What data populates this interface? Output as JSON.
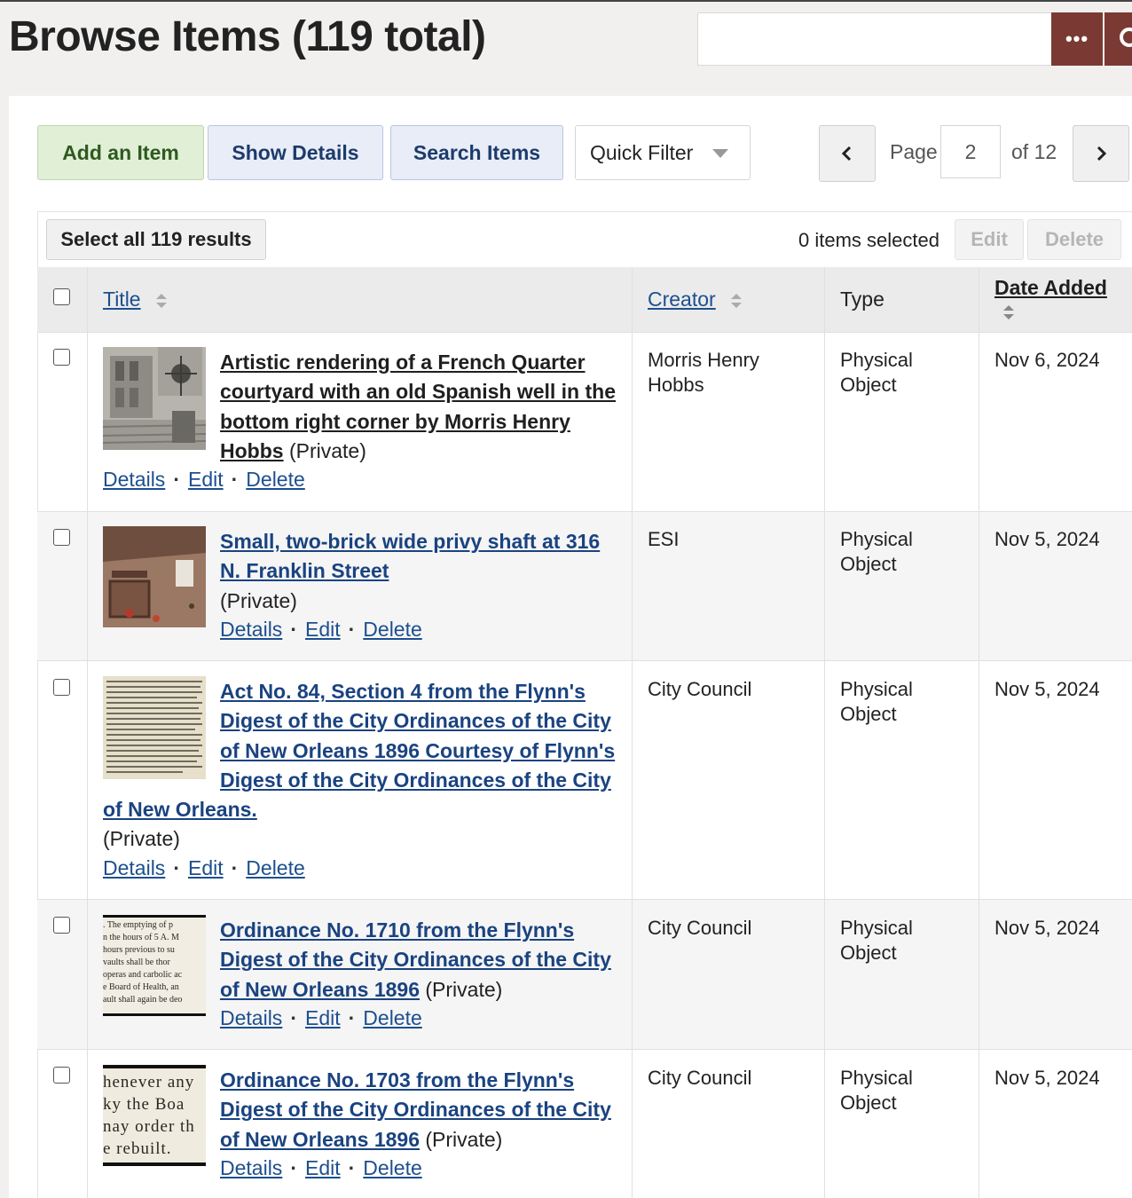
{
  "header": {
    "title": "Browse Items (119 total)",
    "search_value": "",
    "search_options_label": "•••"
  },
  "toolbar": {
    "add_label": "Add an Item",
    "details_label": "Show Details",
    "search_label": "Search Items",
    "filter_label": "Quick Filter"
  },
  "pagination": {
    "page_label": "Page",
    "current_page": "2",
    "of_label": "of 12"
  },
  "batch": {
    "select_all_label": "Select all 119 results",
    "selected_text": "0 items selected",
    "edit_label": "Edit",
    "delete_label": "Delete"
  },
  "table": {
    "columns": {
      "title": "Title",
      "creator": "Creator",
      "type": "Type",
      "date": "Date Added"
    },
    "rows": [
      {
        "title": "Artistic rendering of a French Quarter courtyard with an old Spanish well in the bottom right corner by Morris Henry Hobbs",
        "status": "(Private)",
        "creator": "Morris Henry Hobbs",
        "type": "Physical Object",
        "date": "Nov 6, 2024",
        "thumb": "sketch-courtyard"
      },
      {
        "title": "Small, two-brick wide privy shaft at 316 N. Franklin Street",
        "status": "(Private)",
        "creator": "ESI",
        "type": "Physical Object",
        "date": "Nov 5, 2024",
        "thumb": "excavation-photo"
      },
      {
        "title": "Act No. 84, Section 4 from the Flynn's Digest of the City Ordinances of the City of New Orleans 1896 Courtesy of Flynn's Digest of the City Ordinances of the City of New Orleans.",
        "status": "(Private)",
        "creator": "City Council",
        "type": "Physical Object",
        "date": "Nov 5, 2024",
        "thumb": "newsprint-page"
      },
      {
        "title": "Ordinance No. 1710 from the Flynn's Digest of the City Ordinances of the City of New Orleans 1896",
        "status": "(Private)",
        "creator": "City Council",
        "type": "Physical Object",
        "date": "Nov 5, 2024",
        "thumb": "newsprint-snippet",
        "thumb_lines": [
          ". The emptying of p",
          "n the hours of 5 A. M",
          "hours previous to su",
          "vaults shall be thor",
          "operas and carbolic ac",
          "e Board of Health, an",
          "ault shall again be deo"
        ]
      },
      {
        "title": "Ordinance No. 1703 from the Flynn's Digest of the City Ordinances of the City of New Orleans 1896",
        "status": "(Private)",
        "creator": "City Council",
        "type": "Physical Object",
        "date": "Nov 5, 2024",
        "thumb": "newsprint-large",
        "thumb_lines": [
          "henever any",
          "ky the Boa",
          "nay order th",
          "e rebuilt."
        ]
      }
    ],
    "action_labels": {
      "details": "Details",
      "edit": "Edit",
      "delete": "Delete",
      "separator": "·"
    }
  }
}
